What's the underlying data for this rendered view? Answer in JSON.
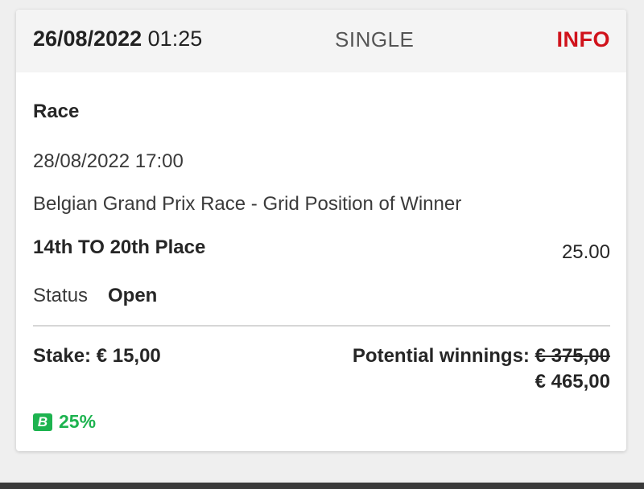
{
  "header": {
    "date": "26/08/2022",
    "time": "01:25",
    "bet_type": "SINGLE",
    "info_label": "INFO"
  },
  "bet": {
    "sport": "Race",
    "event_datetime": "28/08/2022 17:00",
    "market": "Belgian Grand Prix Race - Grid Position of Winner",
    "selection": "14th TO 20th Place",
    "odds": "25.00",
    "status_label": "Status",
    "status_value": "Open"
  },
  "summary": {
    "stake": "Stake: € 15,00",
    "potential_label": "Potential winnings:",
    "potential_old": "€ 375,00",
    "potential_new": "€ 465,00"
  },
  "bonus": {
    "icon": "B",
    "icon_name": "bonus-b-icon",
    "percent": "25%"
  },
  "colors": {
    "accent_red": "#d0121b",
    "bonus_green": "#1db34f"
  }
}
